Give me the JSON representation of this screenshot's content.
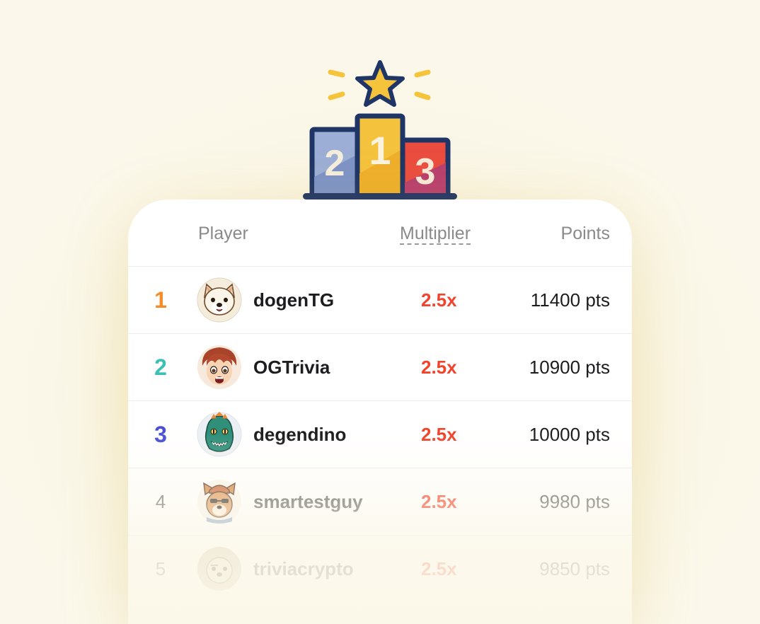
{
  "podium_icon": {
    "icon": "podium-star-icon",
    "places": [
      "2",
      "1",
      "3"
    ],
    "colors": {
      "outline": "#1f3566",
      "star": "#f5c43b",
      "first": "#f4c23d",
      "second": "#9caed5",
      "third": "#ea4d3f"
    }
  },
  "leaderboard": {
    "columns": {
      "player": "Player",
      "multiplier": "Multiplier",
      "points": "Points"
    },
    "rows": [
      {
        "rank": "1",
        "name": "dogenTG",
        "multiplier": "2.5x",
        "points": "11400 pts",
        "avatar": "shiba-dog-avatar"
      },
      {
        "rank": "2",
        "name": "OGTrivia",
        "multiplier": "2.5x",
        "points": "10900 pts",
        "avatar": "anime-boy-avatar"
      },
      {
        "rank": "3",
        "name": "degendino",
        "multiplier": "2.5x",
        "points": "10000 pts",
        "avatar": "dino-avatar"
      },
      {
        "rank": "4",
        "name": "smartestguy",
        "multiplier": "2.5x",
        "points": "9980 pts",
        "avatar": "dog-beanie-avatar"
      },
      {
        "rank": "5",
        "name": "triviacrypto",
        "multiplier": "2.5x",
        "points": "9850 pts",
        "avatar": "dog-avatar"
      }
    ]
  },
  "colors": {
    "rank1": "#f68b2c",
    "rank2": "#3cbfb4",
    "rank3": "#4a4fd6",
    "multiplier": "#f0442c",
    "background": "#fbf6e6"
  }
}
